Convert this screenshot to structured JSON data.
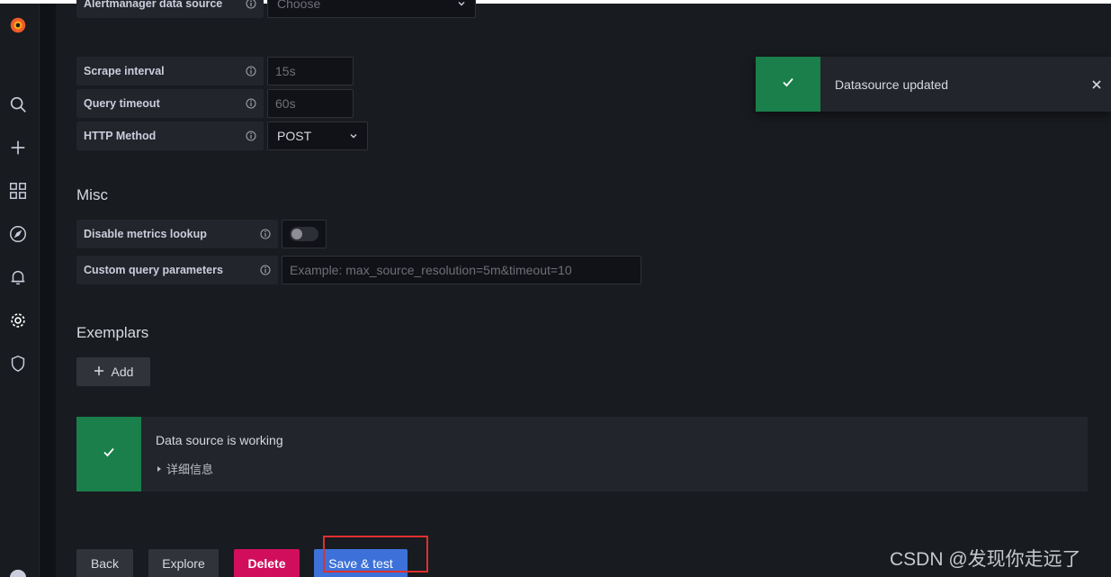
{
  "form": {
    "top_row": {
      "label": "Alertmanager data source",
      "value": "Choose"
    },
    "scrape_interval": {
      "label": "Scrape interval",
      "value": "15s"
    },
    "query_timeout": {
      "label": "Query timeout",
      "value": "60s"
    },
    "http_method": {
      "label": "HTTP Method",
      "value": "POST"
    }
  },
  "misc": {
    "title": "Misc",
    "disable_metrics_lookup": {
      "label": "Disable metrics lookup",
      "enabled": false
    },
    "custom_query_parameters": {
      "label": "Custom query parameters",
      "placeholder": "Example: max_source_resolution=5m&timeout=10"
    }
  },
  "exemplars": {
    "title": "Exemplars",
    "add_label": "Add"
  },
  "alert": {
    "title": "Data source is working",
    "details_label": "详细信息"
  },
  "actions": {
    "back": "Back",
    "explore": "Explore",
    "delete": "Delete",
    "save": "Save & test"
  },
  "toast": {
    "message": "Datasource updated"
  },
  "watermark": "CSDN @发现你走远了",
  "colors": {
    "success": "#1a7f4b",
    "danger": "#d10e5c",
    "primary": "#3d71d9",
    "highlight": "#e02f2f"
  }
}
